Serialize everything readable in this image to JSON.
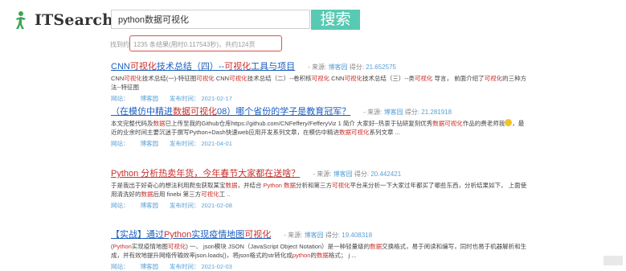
{
  "logo": {
    "text": "ITSearch",
    "icon": "person-icon"
  },
  "search": {
    "query": "python数据可视化",
    "button_label": "搜索"
  },
  "stats": {
    "prefix": "找到约",
    "summary": "1235 条结果(用时0.117543秒)，共约124页"
  },
  "results": [
    {
      "title_parts": [
        {
          "t": "CNN",
          "hl": false
        },
        {
          "t": "可视化",
          "hl": true
        },
        {
          "t": "技术总结（四）--",
          "hl": false
        },
        {
          "t": "可视化",
          "hl": true
        },
        {
          "t": "工具与项目",
          "hl": false
        }
      ],
      "title_color": "blue",
      "meta_source_label": "- 来源:",
      "source": "博客园",
      "score_label": "得分:",
      "score": "21.652575",
      "snippet_lines": [
        [
          {
            "t": "CNN",
            "hl": false
          },
          {
            "t": "可视化",
            "hl": true
          },
          {
            "t": "技术总结(一)-特征图",
            "hl": false
          },
          {
            "t": "可视化",
            "hl": true
          },
          {
            "t": " CNN",
            "hl": false
          },
          {
            "t": "可视化",
            "hl": true
          },
          {
            "t": "技术总结（二）--卷积核",
            "hl": false
          },
          {
            "t": "可视化",
            "hl": true
          },
          {
            "t": " CNN",
            "hl": false
          },
          {
            "t": "可视化",
            "hl": true
          },
          {
            "t": "技术总结（三）--类",
            "hl": false
          },
          {
            "t": "可视化",
            "hl": true
          },
          {
            "t": " 导言，  前面介绍了",
            "hl": false
          },
          {
            "t": "可视化",
            "hl": true
          },
          {
            "t": "的三种方",
            "hl": false
          }
        ],
        [
          {
            "t": "法--特征图",
            "hl": false
          }
        ]
      ],
      "foot": {
        "site": "网站：",
        "source": "博客园",
        "time_label": "发布时间：",
        "date": "2021-02-17"
      }
    },
    {
      "title_parts": [
        {
          "t": "（在模仿中精进",
          "hl": false
        },
        {
          "t": "数据可视化",
          "hl": true
        },
        {
          "t": "08）哪个省份的学子是教育冠军？",
          "hl": false
        }
      ],
      "title_color": "blue",
      "meta_source_label": "- 来源:",
      "source": "博客园",
      "score_label": "得分:",
      "score": "21.281918",
      "snippet_lines": [
        [
          {
            "t": "本文完整代码及",
            "hl": false
          },
          {
            "t": "数据",
            "hl": true
          },
          {
            "t": "已上传至我的Github仓库https://github.com/CNFeffery/FefferyViz 1 简介 大家好~热衷于钻研复刻优秀",
            "hl": false
          },
          {
            "t": "数据可视化",
            "hl": true
          },
          {
            "t": "作品的费老师我",
            "hl": false
          },
          {
            "t": "[emoji]",
            "hl": false
          },
          {
            "t": "，最",
            "hl": false
          }
        ],
        [
          {
            "t": "近的业余时间主要沉迷于撰写Python+Dash快速web应用开发系列文章，在模仿中精进",
            "hl": false
          },
          {
            "t": "数据可视化",
            "hl": true
          },
          {
            "t": "系列文章 ...",
            "hl": false
          }
        ]
      ],
      "foot": {
        "site": "网站：",
        "source": "博客园",
        "time_label": "发布时间：",
        "date": "2021-04-01"
      }
    },
    {
      "title_parts": [
        {
          "t": "Python 分析热卖年货，今年春节大家都在送啥？",
          "hl": false
        }
      ],
      "title_color": "red",
      "meta_source_label": "- 来源:",
      "source": "博客园",
      "score_label": "得分:",
      "score": "20.442421",
      "snippet_lines": [
        [
          {
            "t": "于是我出于好奇心的想法利用爬虫获取某宝",
            "hl": false
          },
          {
            "t": "数据",
            "hl": true
          },
          {
            "t": "，并结合 ",
            "hl": false
          },
          {
            "t": "Python 数据",
            "hl": true
          },
          {
            "t": "分析和第三方",
            "hl": false
          },
          {
            "t": "可视化",
            "hl": true
          },
          {
            "t": "平台来分析一下大家过年都买了哪些东西，分析结果如下，  上面使",
            "hl": false
          }
        ],
        [
          {
            "t": "用清洗好的",
            "hl": false
          },
          {
            "t": "数据",
            "hl": true
          },
          {
            "t": "后用 finebi 第三方",
            "hl": false
          },
          {
            "t": "可视化",
            "hl": true
          },
          {
            "t": "工 ..",
            "hl": false
          }
        ]
      ],
      "foot": {
        "site": "网站：",
        "source": "博客园",
        "time_label": "发布时间：",
        "date": "2021-02-08"
      }
    },
    {
      "title_parts": [
        {
          "t": "【实战】通过",
          "hl": false
        },
        {
          "t": "Python",
          "hl": true
        },
        {
          "t": "实现疫情地图",
          "hl": false
        },
        {
          "t": "可视化",
          "hl": true
        }
      ],
      "title_color": "blue",
      "meta_source_label": "- 来源:",
      "source": "博客园",
      "score_label": "得分:",
      "score": "19.408318",
      "snippet_lines": [
        [
          {
            "t": "(",
            "hl": false
          },
          {
            "t": "Python",
            "hl": true
          },
          {
            "t": "实现疫情地图",
            "hl": false
          },
          {
            "t": "可视化",
            "hl": true
          },
          {
            "t": ") 一、  json模块 JSON（JavaScript Object Notation）是一种轻量级的",
            "hl": false
          },
          {
            "t": "数据",
            "hl": true
          },
          {
            "t": "交换格式，易于阅读和编写，同时也易于机器解析和生",
            "hl": false
          }
        ],
        [
          {
            "t": "成，并有效地提升网络传输效率json.loads()，将json格式的str转化成",
            "hl": false
          },
          {
            "t": "python",
            "hl": true
          },
          {
            "t": "的",
            "hl": false
          },
          {
            "t": "数据",
            "hl": true
          },
          {
            "t": "格式；  j ...",
            "hl": false
          }
        ]
      ],
      "foot": {
        "site": "网站：",
        "source": "博客园",
        "time_label": "发布时间：",
        "date": "2021-02-03"
      }
    }
  ],
  "colors": {
    "accent": "#58c9b3",
    "link": "#1b5fc1",
    "highlight": "#c9302c",
    "meta": "#5aa0d6",
    "stats_box": "#d9534f"
  }
}
